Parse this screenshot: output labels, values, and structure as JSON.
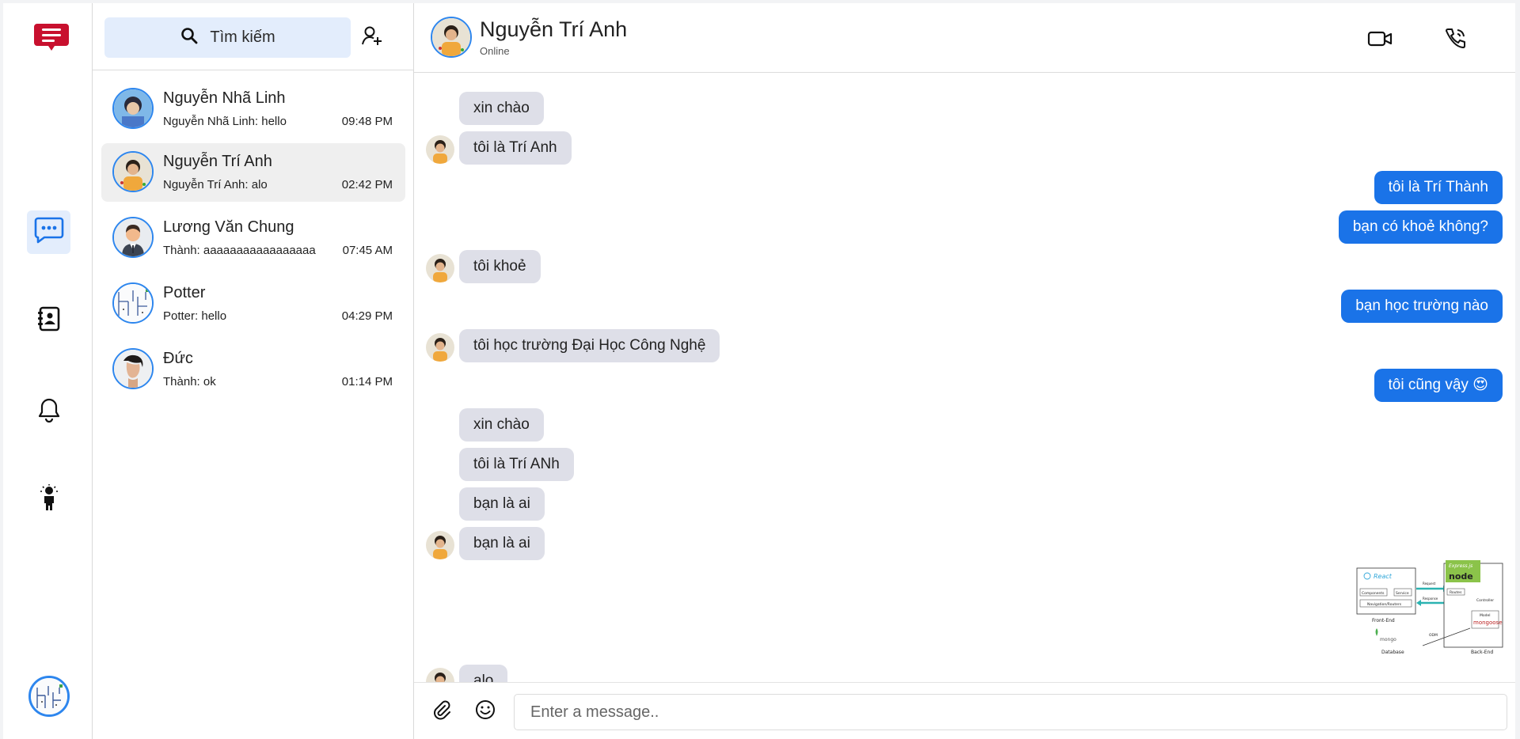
{
  "sidebar": {
    "logo_icon": "chat-logo-icon",
    "nav": [
      {
        "icon": "messages-icon",
        "active": true
      },
      {
        "icon": "contacts-icon",
        "active": false
      },
      {
        "icon": "bell-icon",
        "active": false
      },
      {
        "icon": "idea-person-icon",
        "active": false
      }
    ]
  },
  "search": {
    "label": "Tìm kiếm"
  },
  "conversations": [
    {
      "name": "Nguyễn Nhã Linh",
      "preview": "Nguyễn Nhã Linh: hello",
      "time": "09:48 PM"
    },
    {
      "name": "Nguyễn Trí Anh",
      "preview": "Nguyễn Trí Anh: alo",
      "time": "02:42 PM",
      "active": true
    },
    {
      "name": "Lương Văn Chung",
      "preview": "Thành: aaaaaaaaaaaaaaaaa",
      "time": "07:45 AM"
    },
    {
      "name": "Potter",
      "preview": "Potter: hello",
      "time": "04:29 PM"
    },
    {
      "name": "Đức",
      "preview": "Thành: ok",
      "time": "01:14 PM"
    }
  ],
  "chat": {
    "title": "Nguyễn Trí Anh",
    "status": "Online",
    "messages": [
      {
        "dir": "in",
        "text": "xin chào"
      },
      {
        "dir": "in",
        "text": "tôi là Trí Anh"
      },
      {
        "dir": "out",
        "text": "tôi là Trí Thành"
      },
      {
        "dir": "out",
        "text": "bạn có khoẻ không?"
      },
      {
        "dir": "in",
        "text": "tôi khoẻ"
      },
      {
        "dir": "out",
        "text": "bạn học trường nào"
      },
      {
        "dir": "in",
        "text": "tôi học trường Đại Học Công Nghệ"
      },
      {
        "dir": "out",
        "text": "tôi cũng vậy 😍"
      },
      {
        "dir": "in",
        "text": "xin chào"
      },
      {
        "dir": "in",
        "text": "tôi là Trí ANh"
      },
      {
        "dir": "in",
        "text": "bạn là ai"
      },
      {
        "dir": "in",
        "text": "bạn là ai"
      },
      {
        "dir": "in",
        "text": "alo"
      }
    ],
    "image_message": {
      "react_label": "React",
      "components_label": "Components",
      "service_label": "Service",
      "navigation_label": "Navigation/Routers",
      "frontend_label": "Front-End",
      "request_label": "Request",
      "response_label": "Response",
      "express_label": "Express.js",
      "node_label": "node",
      "routes_label": "Routes",
      "controller_label": "Controller",
      "model_label": "Model",
      "mongoose_label": "mongoose",
      "backend_label": "Back-End",
      "odm_label": "ODM",
      "mongo_label": "mongo",
      "database_label": "Database"
    }
  },
  "composer": {
    "placeholder": "Enter a message.."
  }
}
